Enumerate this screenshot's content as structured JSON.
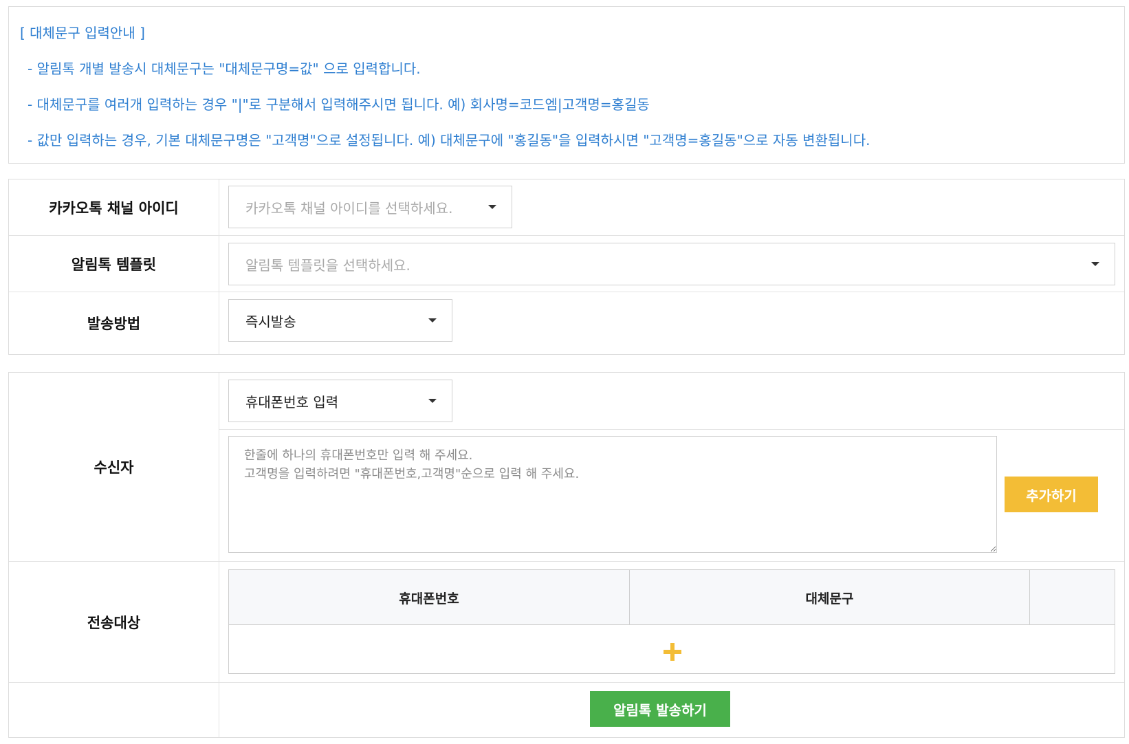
{
  "notice": {
    "title": "[ 대체문구 입력안내 ]",
    "lines": [
      "- 알림톡 개별 발송시 대체문구는 \"대체문구명=값\" 으로 입력합니다.",
      "- 대체문구를 여러개 입력하는 경우 \"|\"로 구분해서 입력해주시면 됩니다. 예) 회사명=코드엠|고객명=홍길동",
      "- 값만 입력하는 경우, 기본 대체문구명은 \"고객명\"으로 설정됩니다. 예) 대체문구에 \"홍길동\"을 입력하시면 \"고객명=홍길동\"으로 자동 변환됩니다."
    ]
  },
  "form": {
    "channel": {
      "label": "카카오톡 채널 아이디",
      "placeholder": "카카오톡 채널 아이디를 선택하세요."
    },
    "template": {
      "label": "알림톡 템플릿",
      "placeholder": "알림톡 템플릿을 선택하세요."
    },
    "method": {
      "label": "발송방법",
      "value": "즉시발송"
    },
    "recipient": {
      "label": "수신자",
      "input_type": "휴대폰번호 입력",
      "textarea_placeholder": "한줄에 하나의 휴대폰번호만 입력 해 주세요.\n고객명을 입력하려면 \"휴대폰번호,고객명\"순으로 입력 해 주세요.",
      "add_button": "추가하기"
    },
    "targets": {
      "label": "전송대상",
      "columns": [
        "휴대폰번호",
        "대체문구",
        ""
      ]
    },
    "submit_button": "알림톡 발송하기"
  },
  "colors": {
    "notice_text": "#2f7fd1",
    "accent_yellow": "#f3bd36",
    "submit_green": "#49b04b"
  }
}
